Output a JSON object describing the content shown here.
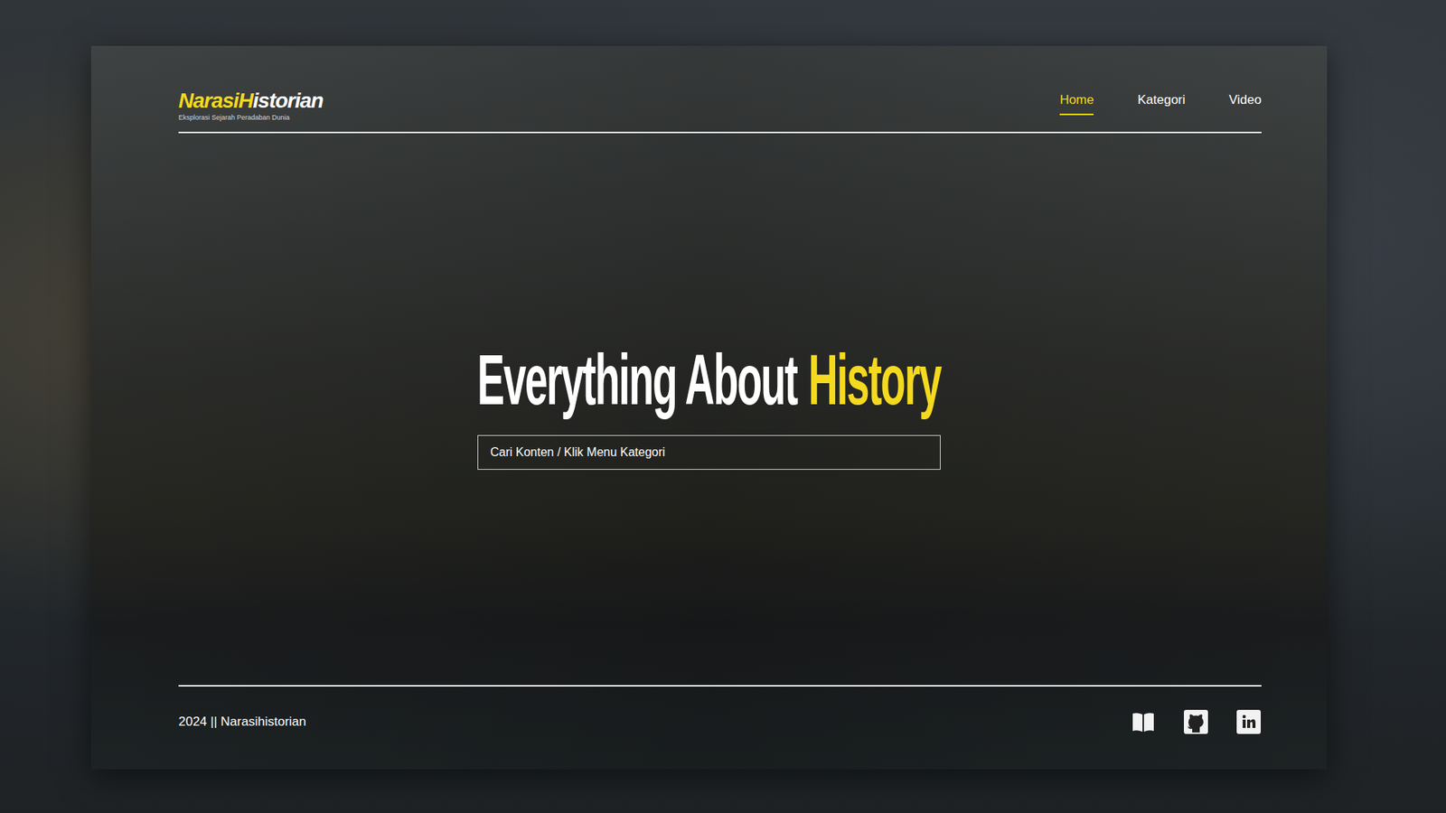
{
  "logo": {
    "parts": [
      {
        "text": "NarasiH",
        "highlight": true
      },
      {
        "text": "istorian",
        "highlight": false
      }
    ],
    "tagline": "Eksplorasi Sejarah Peradaban Dunia"
  },
  "nav": [
    {
      "label": "Home",
      "selected": true
    },
    {
      "label": "Kategori",
      "selected": false
    },
    {
      "label": "Video",
      "selected": false
    }
  ],
  "hero": {
    "title": [
      {
        "text": "Everything About",
        "highlight": false
      },
      {
        "text": "History",
        "highlight": true
      }
    ]
  },
  "search": {
    "placeholder": "Cari Konten / Klik Menu Kategori"
  },
  "footer": {
    "copyright": "2024 || Narasihistorian",
    "links": [
      {
        "kind": "book"
      },
      {
        "kind": "github"
      },
      {
        "kind": "linkedin"
      }
    ]
  }
}
